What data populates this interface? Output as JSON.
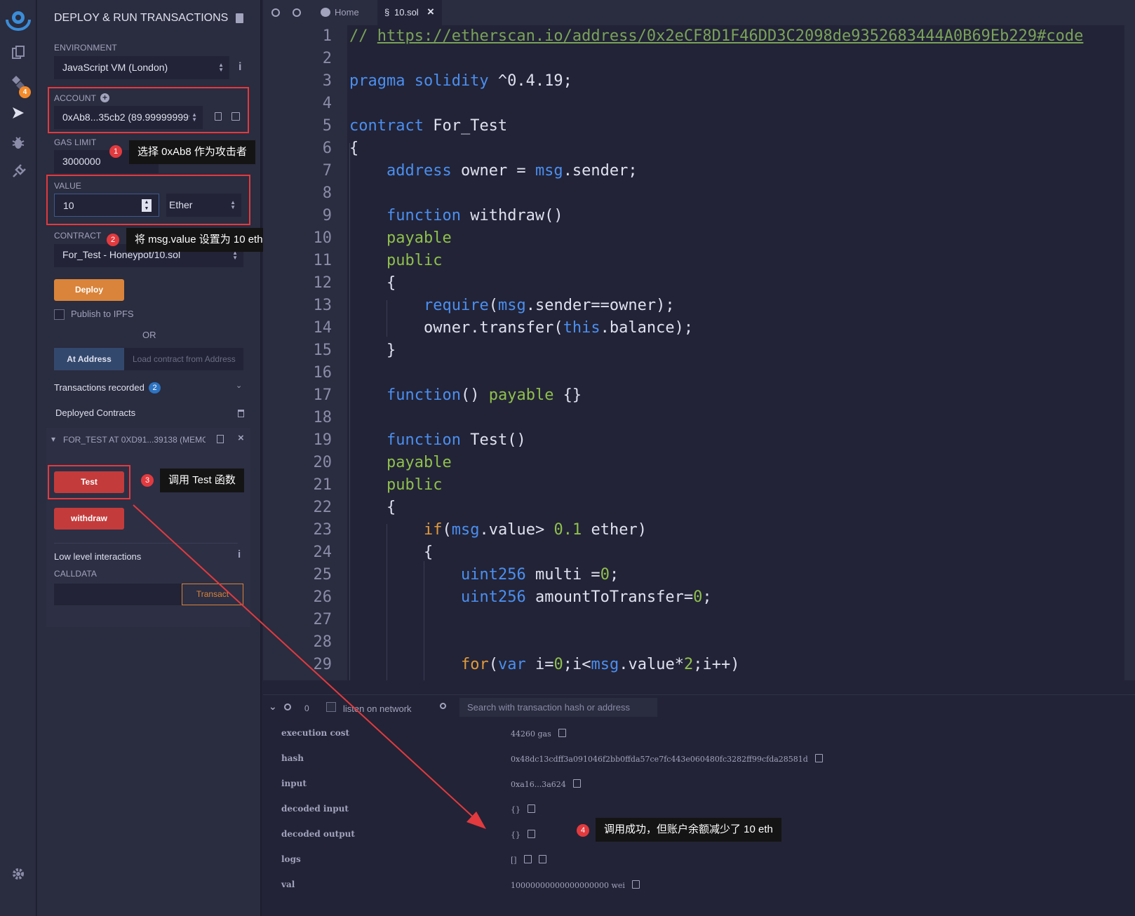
{
  "panel": {
    "title": "DEPLOY & RUN TRANSACTIONS",
    "environment_label": "ENVIRONMENT",
    "environment_value": "JavaScript VM (London)",
    "account_label": "ACCOUNT",
    "account_value": "0xAb8...35cb2 (89.999999999",
    "gas_limit_label": "GAS LIMIT",
    "gas_limit_value": "3000000",
    "value_label": "VALUE",
    "value_value": "10",
    "value_unit": "Ether",
    "contract_label": "CONTRACT",
    "contract_value": "For_Test - Honeypot/10.sol",
    "deploy_label": "Deploy",
    "publish_label": "Publish to IPFS",
    "or_label": "OR",
    "at_address_label": "At Address",
    "load_contract_placeholder": "Load contract from Address",
    "transactions_recorded_label": "Transactions recorded",
    "transactions_recorded_count": "2",
    "deployed_contracts_label": "Deployed Contracts",
    "instance_label": "FOR_TEST AT 0XD91...39138 (MEMOR",
    "test_button": "Test",
    "withdraw_button": "withdraw",
    "low_level_label": "Low level interactions",
    "calldata_label": "CALLDATA",
    "transact_label": "Transact"
  },
  "rail": {
    "plugin_badge": "4"
  },
  "annotations": {
    "a1_num": "1",
    "a1_text": "选择 0xAb8 作为攻击者",
    "a2_num": "2",
    "a2_text": "将 msg.value 设置为 10 eth",
    "a3_num": "3",
    "a3_text": "调用 Test 函数",
    "a4_num": "4",
    "a4_text": "调用成功，但账户余额减少了 10 eth"
  },
  "tabs": {
    "home": "Home",
    "file": "10.sol"
  },
  "code": {
    "line_numbers": [
      "1",
      "2",
      "3",
      "4",
      "5",
      "6",
      "7",
      "8",
      "9",
      "10",
      "11",
      "12",
      "13",
      "14",
      "15",
      "16",
      "17",
      "18",
      "19",
      "20",
      "21",
      "22",
      "23",
      "24",
      "25",
      "26",
      "27",
      "28",
      "29"
    ],
    "l1_comment": "// ",
    "l1_url": "https://etherscan.io/address/0x2eCF8D1F46DD3C2098de9352683444A0B69Eb229#code",
    "l3_kw": "pragma solidity",
    "l3_ver": " ^0.4.19;",
    "l5_kw": "contract",
    "l5_name": " For_Test",
    "l6": "{",
    "l7_kw": "address",
    "l7_mid": " owner = ",
    "l7_msg": "msg",
    "l7_end": ".sender;",
    "l9_kw": "function",
    "l9_name": " withdraw()",
    "l10": "payable",
    "l11": "public",
    "l12": "{",
    "l13_fn": "require",
    "l13_p": "(",
    "l13_msg": "msg",
    "l13_end": ".sender==owner);",
    "l14_a": "owner.transfer(",
    "l14_this": "this",
    "l14_b": ".balance);",
    "l15": "}",
    "l17_kw": "function",
    "l17_mid": "() ",
    "l17_pay": "payable",
    "l17_end": " {}",
    "l19_kw": "function",
    "l19_name": " Test()",
    "l20": "payable",
    "l21": "public",
    "l22": "{",
    "l23_if": "if",
    "l23_p": "(",
    "l23_msg": "msg",
    "l23_mid": ".value> ",
    "l23_num": "0.1",
    "l23_end": " ether)",
    "l24": "{",
    "l25_t": "uint256",
    "l25_mid": " multi =",
    "l25_n": "0",
    "l25_e": ";",
    "l26_t": "uint256",
    "l26_mid": " amountToTransfer=",
    "l26_n": "0",
    "l26_e": ";",
    "l29_for": "for",
    "l29_p": "(",
    "l29_var": "var",
    "l29_a": " i=",
    "l29_n0": "0",
    "l29_b": ";i<",
    "l29_msg": "msg",
    "l29_c": ".value*",
    "l29_n2": "2",
    "l29_d": ";i++)"
  },
  "terminal": {
    "count": "0",
    "listen_label": "listen on network",
    "search_placeholder": "Search with transaction hash or address",
    "rows": [
      {
        "key": "execution cost",
        "value": "44260 gas"
      },
      {
        "key": "hash",
        "value": "0x48dc13cdff3a091046f2bb0ffda57ce7fc443e060480fc3282ff99cfda28581d"
      },
      {
        "key": "input",
        "value": "0xa16...3a624"
      },
      {
        "key": "decoded input",
        "value": "{}"
      },
      {
        "key": "decoded output",
        "value": "{}"
      },
      {
        "key": "logs",
        "value": "[]"
      },
      {
        "key": "val",
        "value": "10000000000000000000 wei"
      }
    ]
  }
}
